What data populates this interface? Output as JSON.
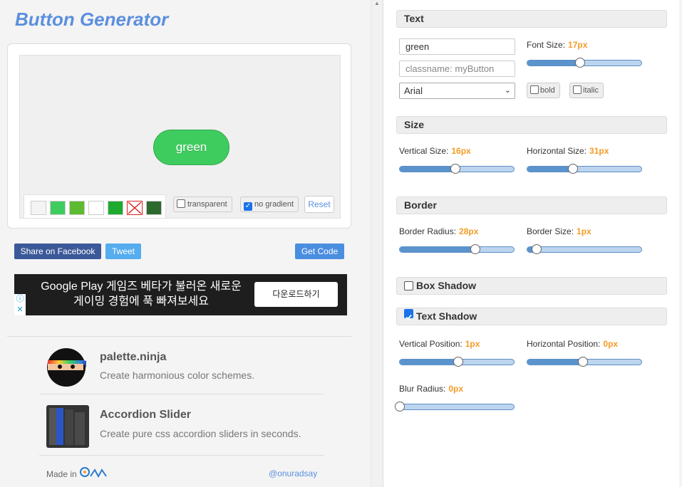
{
  "app": {
    "title": "Button Generator"
  },
  "preview": {
    "button_text": "green",
    "swatches": [
      "#f4f4f4",
      "#3fcc5e",
      "#5dbb2f",
      "#ffffff",
      "#1eaa2e",
      "none",
      "#2d6a2d"
    ],
    "transparent_label": "transparent",
    "no_gradient_label": "no gradient",
    "reset_label": "Reset"
  },
  "share": {
    "facebook_label": "Share on Facebook",
    "tweet_label": "Tweet",
    "get_code_label": "Get Code"
  },
  "ad": {
    "line1": "Google Play 게임즈 베타가 불러온 새로운",
    "line2": "게이밍 경험에 푹 빠져보세요",
    "cta": "다운로드하기"
  },
  "promos": [
    {
      "title": "palette.ninja",
      "desc": "Create harmonious color schemes."
    },
    {
      "title": "Accordion Slider",
      "desc": "Create pure css accordion sliders in seconds."
    }
  ],
  "footer": {
    "made_in": "Made in",
    "handle": "@onuradsay"
  },
  "text_section": {
    "header": "Text",
    "text_value": "green",
    "classname_placeholder": "classname: myButton",
    "font": "Arial",
    "font_size_label": "Font Size:",
    "font_size_value": "17px",
    "font_size_fraction": 0.46,
    "bold_label": "bold",
    "italic_label": "italic"
  },
  "size_section": {
    "header": "Size",
    "vertical_label": "Vertical Size:",
    "vertical_value": "16px",
    "vertical_fraction": 0.49,
    "horizontal_label": "Horizontal Size:",
    "horizontal_value": "31px",
    "horizontal_fraction": 0.4
  },
  "border_section": {
    "header": "Border",
    "radius_label": "Border Radius:",
    "radius_value": "28px",
    "radius_fraction": 0.66,
    "size_label": "Border Size:",
    "size_value": "1px",
    "size_fraction": 0.08
  },
  "box_shadow": {
    "header": "Box Shadow",
    "checked": false
  },
  "text_shadow": {
    "header": "Text Shadow",
    "checked": true,
    "vertical_label": "Vertical Position:",
    "vertical_value": "1px",
    "vertical_fraction": 0.51,
    "horizontal_label": "Horizontal Position:",
    "horizontal_value": "0px",
    "horizontal_fraction": 0.49,
    "blur_label": "Blur Radius:",
    "blur_value": "0px",
    "blur_fraction": 0.0
  },
  "colors": {
    "accent": "#5b8fdf",
    "value_orange": "#f39c26",
    "button_green": "#3fcc5e"
  }
}
